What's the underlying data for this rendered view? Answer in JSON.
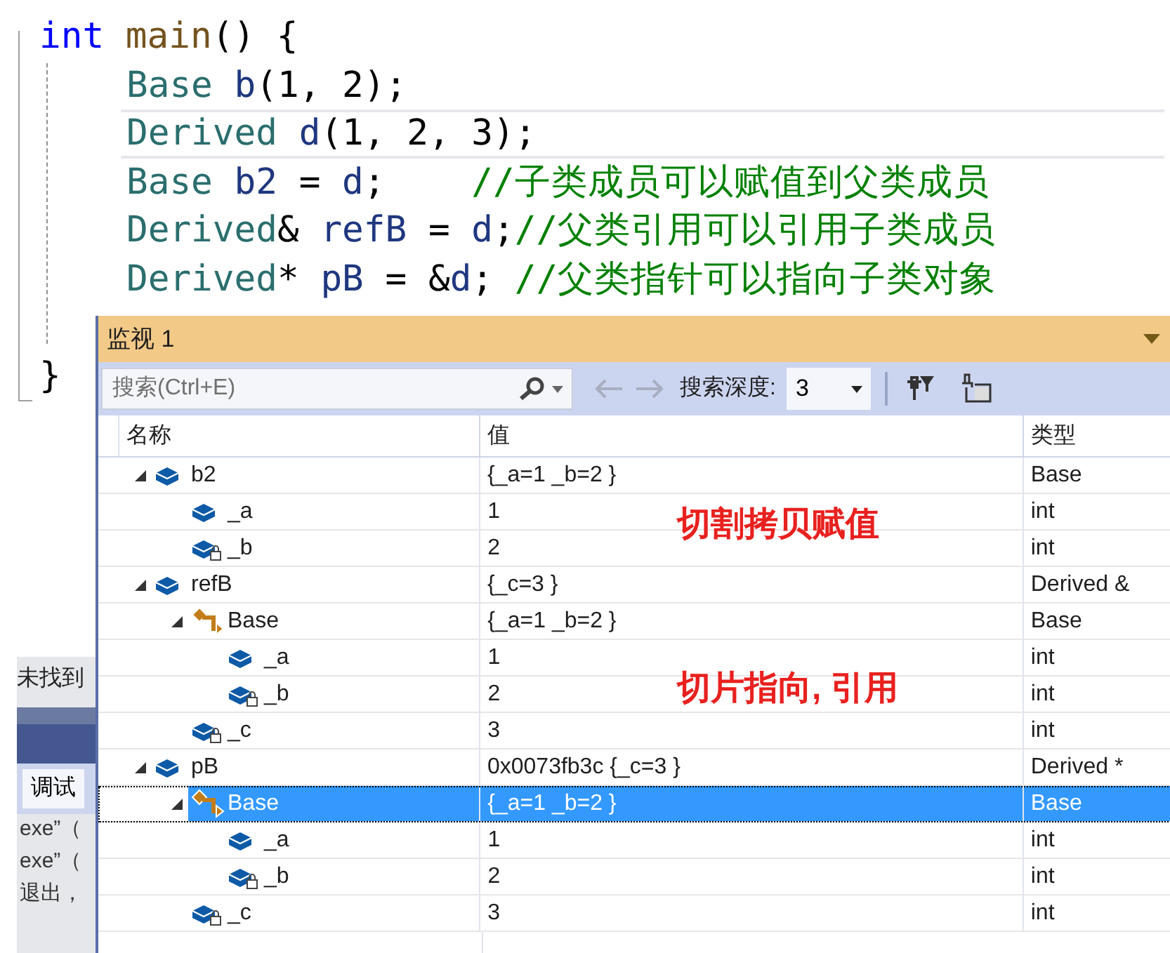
{
  "editor": {
    "lines": [
      {
        "current": false,
        "segments": [
          {
            "kind": "keyword",
            "text": "int"
          },
          {
            "kind": "function",
            "text": " main"
          },
          {
            "kind": "plain",
            "text": "() {"
          }
        ],
        "children": [
          {
            "current": false,
            "segments": [
              {
                "kind": "type",
                "text": "Base"
              },
              {
                "kind": "variable",
                "text": " b"
              },
              {
                "kind": "plain",
                "text": "(1, 2);"
              }
            ]
          },
          {
            "current": true,
            "segments": [
              {
                "kind": "type",
                "text": "Derived"
              },
              {
                "kind": "variable",
                "text": " d"
              },
              {
                "kind": "plain",
                "text": "(1, 2, 3);"
              }
            ]
          },
          {
            "current": false,
            "segments": [
              {
                "kind": "type",
                "text": "Base"
              },
              {
                "kind": "variable",
                "text": " b2"
              },
              {
                "kind": "plain",
                "text": " = "
              },
              {
                "kind": "variable",
                "text": "d"
              },
              {
                "kind": "plain",
                "text": ";    "
              },
              {
                "kind": "comment",
                "text": "//子类成员可以赋值到父类成员"
              }
            ]
          },
          {
            "current": false,
            "segments": [
              {
                "kind": "type",
                "text": "Derived"
              },
              {
                "kind": "plain",
                "text": "& "
              },
              {
                "kind": "variable",
                "text": "refB"
              },
              {
                "kind": "plain",
                "text": " = "
              },
              {
                "kind": "variable",
                "text": "d"
              },
              {
                "kind": "plain",
                "text": ";"
              },
              {
                "kind": "comment",
                "text": "//父类引用可以引用子类成员"
              }
            ]
          },
          {
            "current": false,
            "segments": [
              {
                "kind": "type",
                "text": "Derived"
              },
              {
                "kind": "plain",
                "text": "* "
              },
              {
                "kind": "variable",
                "text": "pB"
              },
              {
                "kind": "plain",
                "text": " = &"
              },
              {
                "kind": "variable",
                "text": "d"
              },
              {
                "kind": "plain",
                "text": "; "
              },
              {
                "kind": "comment",
                "text": "//父类指针可以指向子类对象"
              }
            ]
          }
        ]
      }
    ],
    "closing": "}"
  },
  "output_panel": {
    "message": "未找到",
    "tab": "调试",
    "lines": [
      "exe”（",
      "exe”（",
      "退出，"
    ]
  },
  "watch": {
    "title": "监视 1",
    "search": {
      "placeholder": "搜索(Ctrl+E)"
    },
    "depth_label": "搜索深度:",
    "depth_value": "3",
    "columns": [
      "名称",
      "值",
      "类型"
    ],
    "rows": [
      {
        "name": "b2",
        "value": "{_a=1 _b=2 }",
        "type": "Base",
        "kind": "member",
        "locked": false,
        "expanded": true,
        "selected": false,
        "children": [
          {
            "name": "_a",
            "value": "1",
            "type": "int",
            "kind": "member",
            "locked": false,
            "selected": false
          },
          {
            "name": "_b",
            "value": "2",
            "type": "int",
            "kind": "member",
            "locked": true,
            "selected": false
          }
        ]
      },
      {
        "name": "refB",
        "value": "{_c=3 }",
        "type": "Derived &",
        "kind": "member",
        "locked": false,
        "expanded": true,
        "selected": false,
        "children": [
          {
            "name": "Base",
            "value": "{_a=1 _b=2 }",
            "type": "Base",
            "kind": "base",
            "locked": false,
            "expanded": true,
            "selected": false,
            "children": [
              {
                "name": "_a",
                "value": "1",
                "type": "int",
                "kind": "member",
                "locked": false,
                "selected": false
              },
              {
                "name": "_b",
                "value": "2",
                "type": "int",
                "kind": "member",
                "locked": true,
                "selected": false
              }
            ]
          },
          {
            "name": "_c",
            "value": "3",
            "type": "int",
            "kind": "member",
            "locked": true,
            "selected": false
          }
        ]
      },
      {
        "name": "pB",
        "value": "0x0073fb3c {_c=3 }",
        "type": "Derived *",
        "kind": "member",
        "locked": false,
        "expanded": true,
        "selected": false,
        "children": [
          {
            "name": "Base",
            "value": "{_a=1 _b=2 }",
            "type": "Base",
            "kind": "base",
            "locked": false,
            "expanded": true,
            "selected": true,
            "children": [
              {
                "name": "_a",
                "value": "1",
                "type": "int",
                "kind": "member",
                "locked": false,
                "selected": false
              },
              {
                "name": "_b",
                "value": "2",
                "type": "int",
                "kind": "member",
                "locked": true,
                "selected": false
              }
            ]
          },
          {
            "name": "_c",
            "value": "3",
            "type": "int",
            "kind": "member",
            "locked": true,
            "selected": false
          }
        ]
      }
    ],
    "annotations": [
      "切割拷贝赋值",
      "切片指向, 引用"
    ]
  }
}
